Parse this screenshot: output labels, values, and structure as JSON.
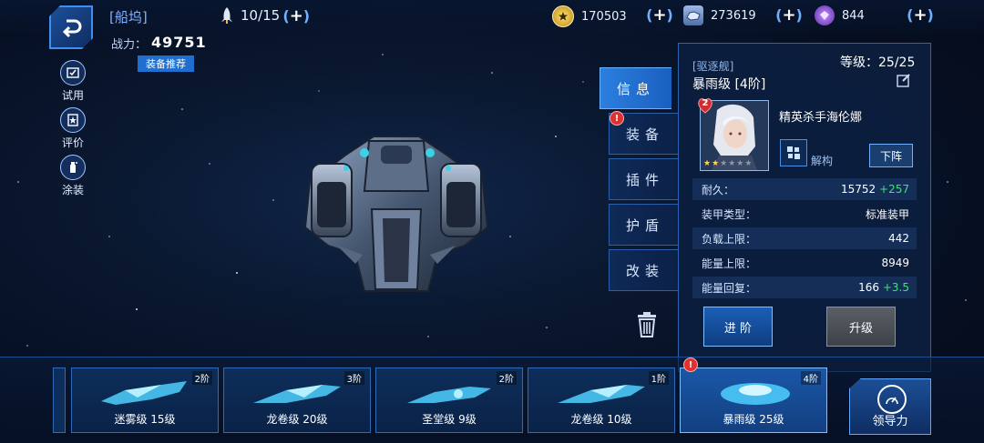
{
  "header": {
    "dock_title": "[船坞]",
    "ship_count": "10/15",
    "power_label": "战力：",
    "power_value": "49751",
    "equip_recommend": "装备推荐"
  },
  "resources": [
    {
      "icon": "star-coin-icon",
      "value": "170503"
    },
    {
      "icon": "ore-icon",
      "value": "273619"
    },
    {
      "icon": "crystal-icon",
      "value": "844"
    }
  ],
  "side_menu": [
    {
      "label": "试用",
      "icon": "trial-icon"
    },
    {
      "label": "评价",
      "icon": "rating-icon"
    },
    {
      "label": "涂装",
      "icon": "paint-icon"
    }
  ],
  "tabs": [
    {
      "label": "信息",
      "active": true
    },
    {
      "label": "装备",
      "alert": "!"
    },
    {
      "label": "插件"
    },
    {
      "label": "护盾"
    },
    {
      "label": "改装"
    }
  ],
  "info": {
    "ship_class": "[驱逐舰]",
    "ship_name": "暴雨级 [4阶]",
    "level": "等级：25/25",
    "captain_level": "2",
    "captain_name": "精英杀手海伦娜",
    "captain_stars": 2,
    "dismantle_label": "解构",
    "unassign_label": "下阵",
    "stats": [
      {
        "key": "耐久：",
        "value": "15752",
        "bonus": "+257"
      },
      {
        "key": "装甲类型：",
        "value": "标准装甲",
        "bonus": ""
      },
      {
        "key": "负载上限：",
        "value": "442",
        "bonus": ""
      },
      {
        "key": "能量上限：",
        "value": "8949",
        "bonus": ""
      },
      {
        "key": "能量回复：",
        "value": "166",
        "bonus": "+3.5"
      }
    ],
    "advance_label": "进 阶",
    "upgrade_label": "升级"
  },
  "ships": [
    {
      "name": "迷雾级 15级",
      "tier": "2阶",
      "selected": false
    },
    {
      "name": "龙卷级 20级",
      "tier": "3阶",
      "selected": false
    },
    {
      "name": "圣堂级 9级",
      "tier": "2阶",
      "selected": false
    },
    {
      "name": "龙卷级 10级",
      "tier": "1阶",
      "selected": false
    },
    {
      "name": "暴雨级 25级",
      "tier": "4阶",
      "selected": true,
      "alert": "!"
    }
  ],
  "lead_button": "领导力",
  "colors": {
    "accent": "#2b7fe0",
    "bonus": "#42e07a",
    "alert": "#e03030"
  }
}
